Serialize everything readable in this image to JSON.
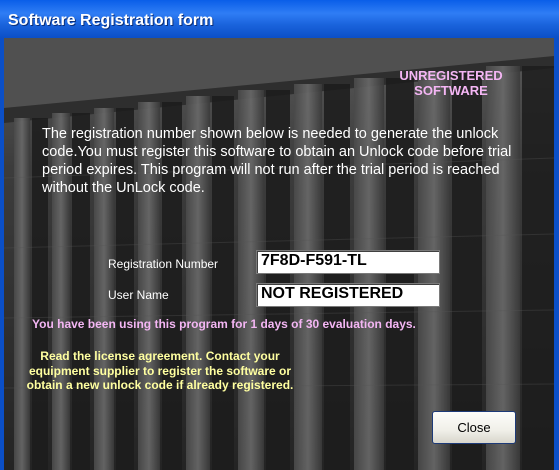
{
  "window": {
    "title": "Software Registration form"
  },
  "status": {
    "heading": "UNREGISTERED SOFTWARE"
  },
  "notice": {
    "text": "The registration number shown below is needed to generate the unlock code.You must register this software to obtain an Unlock code before trial period expires. This program will not run after the trial period is reached without the UnLock code."
  },
  "fields": {
    "registration_number": {
      "label": "Registration Number",
      "value": "7F8D-F591-TL"
    },
    "user_name": {
      "label": "User Name",
      "value": "NOT REGISTERED"
    }
  },
  "usage": {
    "text": "You have been using this program for 1 days of 30 evaluation days."
  },
  "license": {
    "text": "Read the license agreement. Contact your equipment supplier to register the software or obtain a new unlock code if already registered."
  },
  "buttons": {
    "close": "Close"
  },
  "colors": {
    "titlebar": "#0b5be4",
    "heading_pink": "#f4b6f4",
    "license_yellow": "#ffffa0"
  }
}
